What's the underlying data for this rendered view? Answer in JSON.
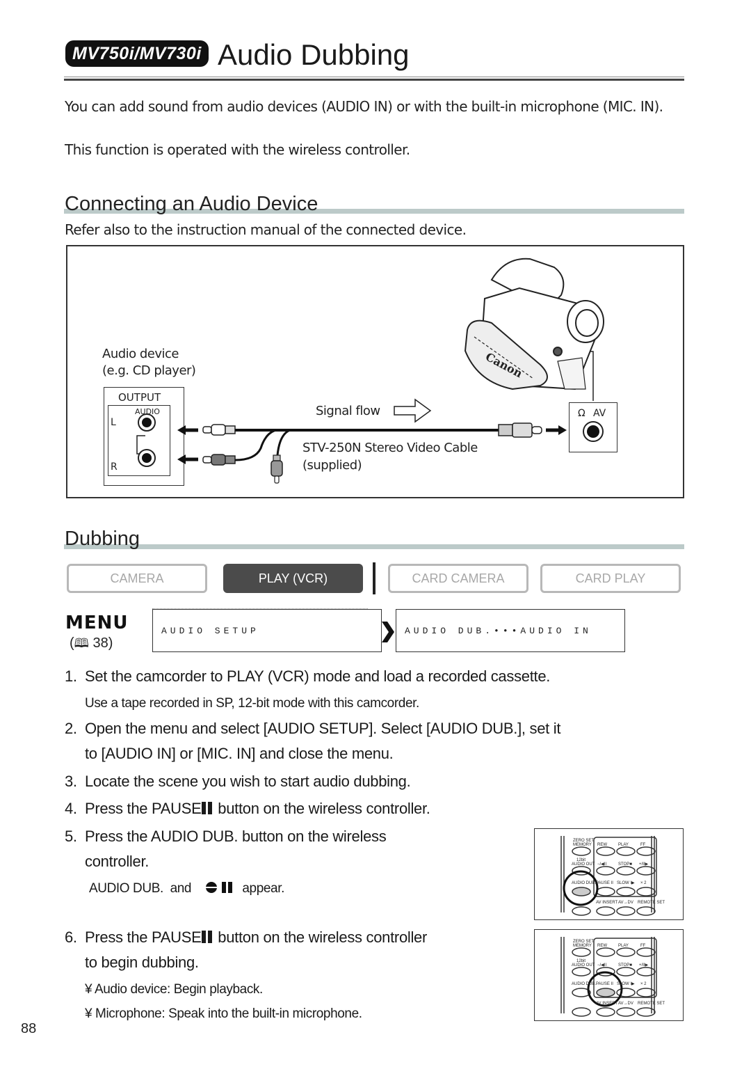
{
  "header": {
    "model_badge": "MV750i/MV730i",
    "title": "Audio Dubbing"
  },
  "intro": {
    "paragraph1": "You can add sound from audio devices (AUDIO IN) or with the built-in microphone (MIC. IN).",
    "paragraph2": "This function is operated with the wireless controller."
  },
  "connecting_section": {
    "title": "Connecting an Audio Device",
    "note": "Refer also to the instruction manual of the connected device.",
    "diagram": {
      "audio_device_label_line1": "Audio device",
      "audio_device_label_line2": "(e.g. CD player)",
      "output_label": "OUTPUT",
      "audio_label": "AUDIO",
      "left_label": "L",
      "right_label": "R",
      "signal_flow_label": "Signal flow",
      "cable_label_line1": "STV-250N Stereo Video Cable",
      "cable_label_line2": "(supplied)",
      "av_label": "AV",
      "camcorder_brand": "Canon"
    }
  },
  "dubbing_section": {
    "title": "Dubbing",
    "modes": [
      {
        "label": "CAMERA",
        "active": false
      },
      {
        "label": "PLAY (VCR)",
        "active": true
      },
      {
        "label": "CARD CAMERA",
        "active": false
      },
      {
        "label": "CARD PLAY",
        "active": false
      }
    ],
    "menu": {
      "label": "MENU",
      "page_ref": "38",
      "item1": "AUDIO SETUP",
      "item2": "AUDIO DUB.•••AUDIO IN"
    },
    "steps": [
      {
        "num": "1.",
        "text": "Set the camcorder to PLAY (VCR) mode and load a recorded cassette."
      },
      {
        "num": "2.",
        "text_line1": "Open the menu and select [AUDIO SETUP]. Select [AUDIO DUB.], set it",
        "text_line2": "to [AUDIO IN] or [MIC. IN] and close the menu."
      },
      {
        "num": "3.",
        "text": "Locate the scene you wish to start audio dubbing."
      },
      {
        "num": "4.",
        "text_before": "Press the PAUSE",
        "text_after": " button on the wireless controller."
      },
      {
        "num": "5.",
        "text_line1": "Press the AUDIO DUB. button on the wireless",
        "text_line2": "controller."
      },
      {
        "num": "6.",
        "text_before": "Press the PAUSE",
        "text_after": " button on the wireless controller",
        "text_line2": "to begin dubbing."
      }
    ],
    "step1_note": "Use a tape recorded in SP, 12-bit mode with this camcorder.",
    "step5_note_before": "AUDIO DUB.  and",
    "step5_note_after": "appear.",
    "step6_bullets": [
      "¥ Audio device: Begin playback.",
      "¥ Microphone: Speak into the built-in microphone."
    ]
  },
  "remote": {
    "labels": {
      "zero_set": "ZERO SET",
      "memory": "MEMORY",
      "rew": "REW",
      "play": "PLAY",
      "ff": "FF",
      "bit12": "12bit",
      "audio_out": "AUDIO OUT",
      "minus": "−/◀II",
      "stop": "STOP■",
      "plus": "+/II▶",
      "audio_dub": "AUDIO DUB.",
      "pause": "PAUSE II",
      "slow": "SLOW I▶",
      "x2": "× 2",
      "av_insert": "AV INSERT",
      "av_dv": "AV→DV",
      "remote_set": "REMOTE SET"
    },
    "highlight1": "AUDIO DUB.",
    "highlight2": "PAUSE"
  },
  "footer": {
    "page_number": "88"
  }
}
